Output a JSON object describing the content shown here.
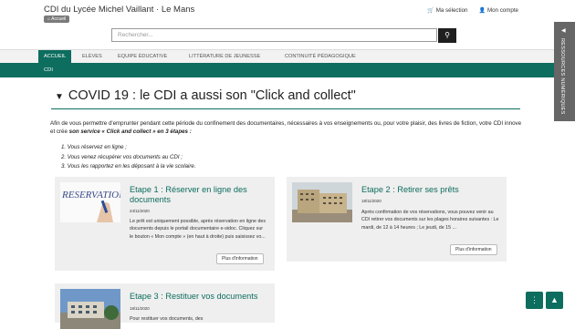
{
  "header": {
    "site_title": "CDI du Lycée Michel Vaillant · Le Mans",
    "home_chip": "Accueil",
    "selection_label": "Ma sélection",
    "account_label": "Mon compte"
  },
  "search": {
    "placeholder": "Rechercher..."
  },
  "nav": {
    "items": [
      {
        "label": "ACCUEIL"
      },
      {
        "label": "ELÈVES"
      },
      {
        "label": "EQUIPE ÉDUCATIVE"
      },
      {
        "label": "LITTÉRATURE DE JEUNESSE"
      },
      {
        "label": "CONTINUITÉ PÉDAGOGIQUE"
      }
    ],
    "active_index": 0
  },
  "subnav": {
    "label": "CDI"
  },
  "side_tab": {
    "label": "RESSOURCES NUMÉRIQUES"
  },
  "main": {
    "heading": "COVID 19 : le CDI a aussi son \"Click and collect\"",
    "intro_plain": "Afin de vous permettre d'emprunter pendant cette période du confinement des documentaires, nécessaires à vos enseignements ou, pour votre plaisir, des livres de fiction, votre CDI innove et crée ",
    "intro_bold": "son service « Click and collect » en 3 étapes :",
    "steps": [
      "Vous réservez en ligne ;",
      "Vous venez récupérer vos documents au CDI ;",
      "Vous les rapportez en les déposant à la vie scolaire."
    ]
  },
  "cards": [
    {
      "title": "Etape 1 : Réserver en ligne des documents",
      "date": "24/11/2020",
      "text": "Le prêt est uniquement possible, après réservation en ligne des documents depuis le portail documentaire e-sidoc. Cliquez sur le bouton « Mon compte » (en haut à droite) puis saisissez vo...",
      "more": "Plus d'information",
      "thumb_word": "RESERVATION"
    },
    {
      "title": "Etape 2 : Retirer ses prêts",
      "date": "18/11/2020",
      "text": "Après confirmation de vos réservations, vous pouvez venir au CDI retirer vos documents sur les plages horaires suivantes :  Le mardi, de 12 à 14 heures ;  Le jeudi, de 15 ...",
      "more": "Plus d'information"
    },
    {
      "title": "Etape 3 : Restituer vos documents",
      "date": "18/11/2020",
      "text": "Pour restituer vos documents, des"
    }
  ],
  "icons": {
    "cart": "cart-icon",
    "user": "user-icon",
    "search": "search-icon",
    "menu": "menu-icon",
    "back_to_top": "arrow-up-icon"
  },
  "colors": {
    "brand": "#0d6d5e",
    "nav_bg": "#f2f2f2",
    "card_bg": "#efefef"
  }
}
